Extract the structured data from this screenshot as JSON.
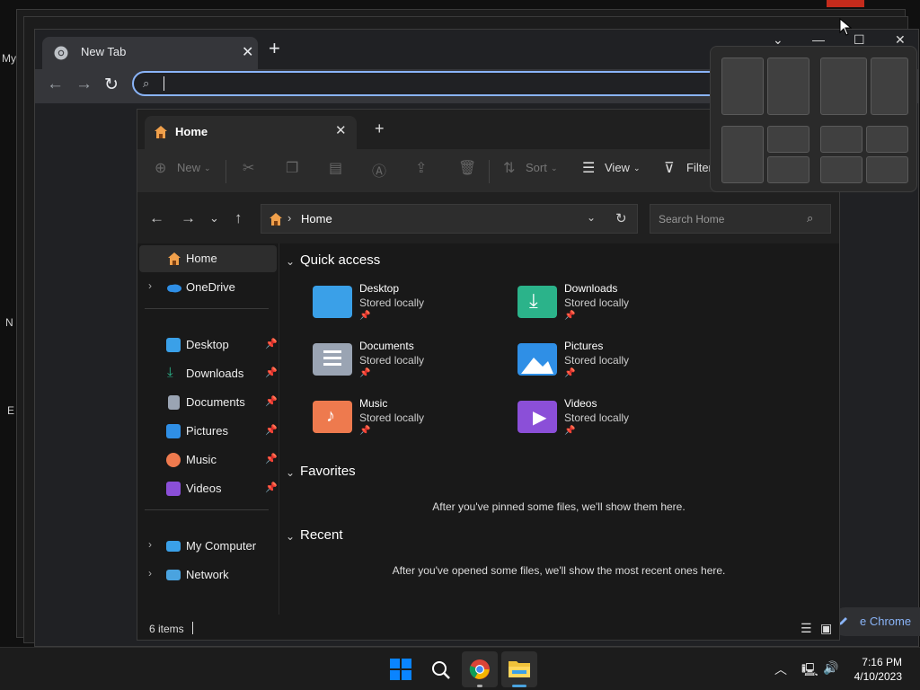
{
  "desktop": {
    "labels": [
      "My",
      "N",
      "E"
    ]
  },
  "chrome": {
    "tab_title": "New Tab",
    "tab_close": "✕",
    "new_tab": "+",
    "omnibox_value": "",
    "customize_label": "Customize Chrome",
    "customize_visible": "e Chrome",
    "controls": {
      "chevron": "⌄",
      "minimize": "—",
      "maximize": "☐",
      "close": "✕"
    }
  },
  "explorer": {
    "tab_title": "Home",
    "tab_close": "✕",
    "new_tab": "+",
    "command_bar": {
      "new": "New",
      "sort": "Sort",
      "view": "View",
      "filter": "Filter"
    },
    "address": {
      "path": "Home",
      "separator": "›"
    },
    "search_placeholder": "Search Home",
    "nav": {
      "home": "Home",
      "onedrive": "OneDrive",
      "pinned": [
        {
          "label": "Desktop"
        },
        {
          "label": "Downloads"
        },
        {
          "label": "Documents"
        },
        {
          "label": "Pictures"
        },
        {
          "label": "Music"
        },
        {
          "label": "Videos"
        }
      ],
      "my_computer": "My Computer",
      "network": "Network"
    },
    "quick_access": {
      "title": "Quick access",
      "items": [
        {
          "name": "Desktop",
          "sub": "Stored locally",
          "color": "#3aa0e8"
        },
        {
          "name": "Downloads",
          "sub": "Stored locally",
          "color": "#2bb38a"
        },
        {
          "name": "Documents",
          "sub": "Stored locally",
          "color": "#9aa4b3"
        },
        {
          "name": "Pictures",
          "sub": "Stored locally",
          "color": "#2f8fe6"
        },
        {
          "name": "Music",
          "sub": "Stored locally",
          "color": "#ee7a4e"
        },
        {
          "name": "Videos",
          "sub": "Stored locally",
          "color": "#8b4fd8"
        }
      ]
    },
    "favorites": {
      "title": "Favorites",
      "empty": "After you've pinned some files, we'll show them here."
    },
    "recent": {
      "title": "Recent",
      "empty": "After you've opened some files, we'll show the most recent ones here."
    },
    "status": "6 items"
  },
  "taskbar": {
    "time": "7:16 PM",
    "date": "4/10/2023"
  },
  "colors": {
    "accent_blue": "#8ab4f8",
    "win_blue": "#0a84ff",
    "folder_yellow": "#f0c23b"
  }
}
